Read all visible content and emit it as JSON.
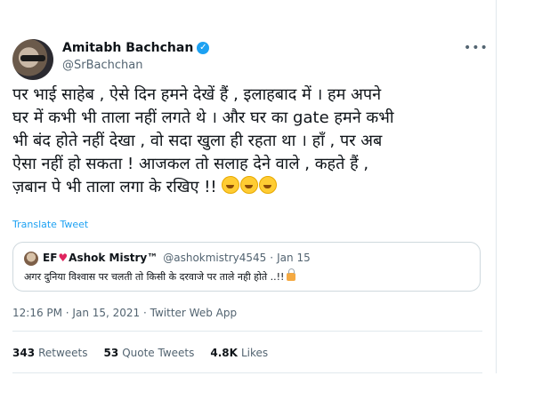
{
  "author": {
    "name": "Amitabh Bachchan",
    "handle": "@SrBachchan",
    "verified": true,
    "more_icon": "more-horizontal-icon"
  },
  "tweet": {
    "lines": [
      "पर भाई  साहेब , ऐसे दिन हमने देखें हैं , इलाहबाद में । हम अपने",
      "घर में कभी भी ताला नहीं लगते थे  । और घर का gate हमने कभी",
      "भी बंद होते नहीं देखा , वो सदा खुला ही रहता था । हाँ , पर अब",
      "ऐसा नहीं हो सकता  ! आजकल तो सलाह देने वाले , कहते हैं ,",
      "ज़बान पे भी ताला लगा के रखिए !!"
    ],
    "emoji": "rolling-on-floor-laughing-icon",
    "translate_label": "Translate Tweet"
  },
  "quoted_tweet": {
    "name_prefix": "EF",
    "name_suffix": "Ashok Mistry™",
    "handle": "@ashokmistry4545",
    "separator": "·",
    "date": "Jan 15",
    "text": "अगर दुनिया विश्वास पर चलती तो किसी के दरवाजे पर ताले नही होते ..!!"
  },
  "meta": {
    "timestamp": "12:16 PM · Jan 15, 2021 · Twitter Web App"
  },
  "stats": {
    "retweets_count": "343",
    "retweets_label": "Retweets",
    "quotes_count": "53",
    "quotes_label": "Quote Tweets",
    "likes_count": "4.8K",
    "likes_label": "Likes"
  },
  "colors": {
    "accent": "#1da1f2",
    "text": "#0f1419",
    "secondary": "#536471",
    "heart": "#e0245e"
  }
}
